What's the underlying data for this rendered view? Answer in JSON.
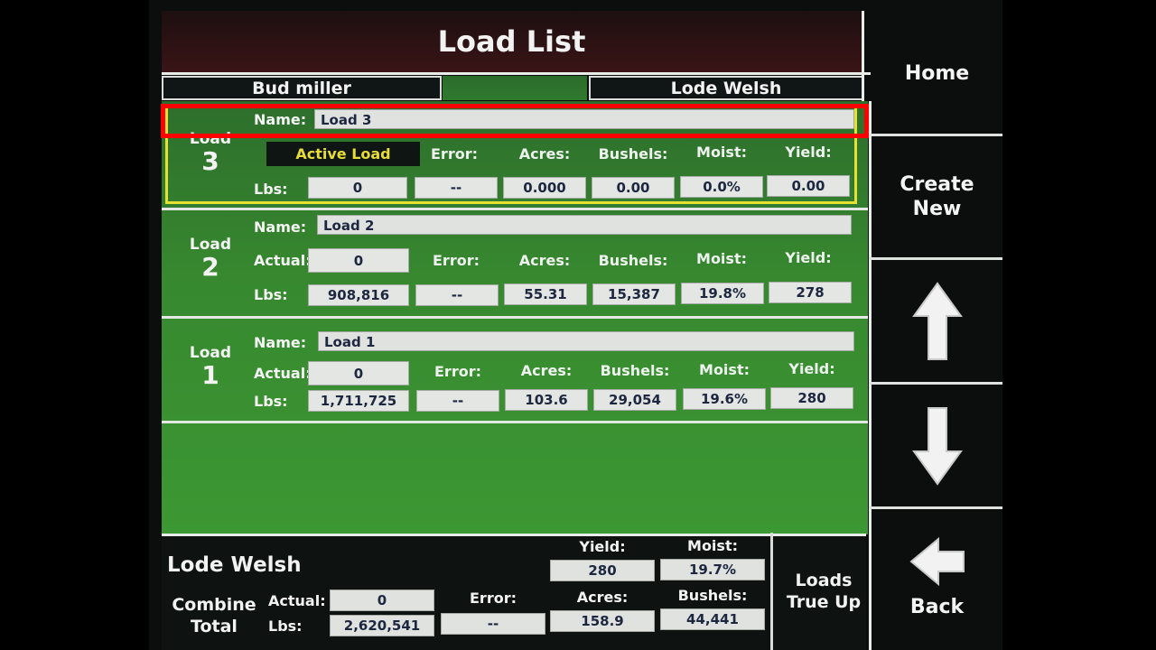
{
  "title": "Load List",
  "operators": {
    "left": "Bud miller",
    "right": "Lode Welsh"
  },
  "labels": {
    "name": "Name:",
    "load": "Load",
    "actual": "Actual:",
    "lbs": "Lbs:",
    "error": "Error:",
    "acres": "Acres:",
    "bushels": "Bushels:",
    "moist": "Moist:",
    "yield": "Yield:",
    "active_load": "Active Load"
  },
  "loads": [
    {
      "number": "3",
      "name": "Load 3",
      "active": true,
      "actual": null,
      "lbs": "0",
      "error": "--",
      "acres": "0.000",
      "bushels": "0.00",
      "moist": "0.0%",
      "yield": "0.00"
    },
    {
      "number": "2",
      "name": "Load 2",
      "active": false,
      "actual": "0",
      "lbs": "908,816",
      "error": "--",
      "acres": "55.31",
      "bushels": "15,387",
      "moist": "19.8%",
      "yield": "278"
    },
    {
      "number": "1",
      "name": "Load 1",
      "active": false,
      "actual": "0",
      "lbs": "1,711,725",
      "error": "--",
      "acres": "103.6",
      "bushels": "29,054",
      "moist": "19.6%",
      "yield": "280"
    }
  ],
  "total": {
    "name": "Lode Welsh",
    "combine_line1": "Combine",
    "combine_line2": "Total",
    "actual_label": "Actual:",
    "lbs_label": "Lbs:",
    "error_label": "Error:",
    "yield_label": "Yield:",
    "moist_label": "Moist:",
    "acres_label": "Acres:",
    "bushels_label": "Bushels:",
    "actual": "0",
    "lbs": "2,620,541",
    "error": "--",
    "yield": "280",
    "moist": "19.7%",
    "acres": "158.9",
    "bushels": "44,441"
  },
  "true_up": {
    "line1": "Loads",
    "line2": "True Up"
  },
  "sidebar": {
    "home": "Home",
    "create_line1": "Create",
    "create_line2": "New",
    "up_icon": "arrow-up-icon",
    "down_icon": "arrow-down-icon",
    "back_icon": "arrow-left-icon",
    "back": "Back"
  },
  "colors": {
    "active_border": "#e6e030",
    "highlight": "#ff0000",
    "panel_green": "#37882f"
  }
}
